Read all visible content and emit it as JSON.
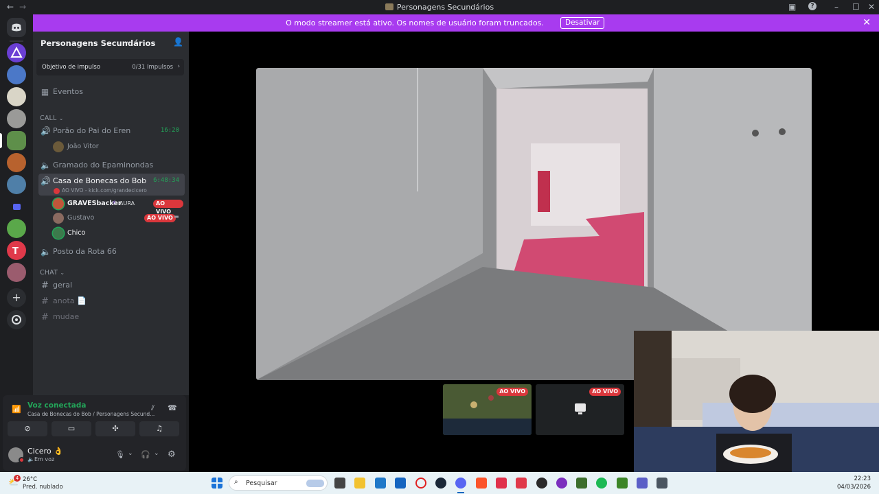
{
  "window": {
    "title": "Personagens Secundários"
  },
  "streamer_banner": {
    "message": "O modo streamer está ativo. Os nomes de usuário foram truncados.",
    "button": "Desativar"
  },
  "server": {
    "name": "Personagens Secundários",
    "boost_label": "Objetivo de impulso",
    "boost_count": "0/31 Impulsos",
    "events": "Eventos"
  },
  "categories": {
    "call": "CALL",
    "chat": "CHAT"
  },
  "voice_channels": [
    {
      "name": "Porão do Pai do Eren",
      "timer": "16:20"
    },
    {
      "name": "Gramado do Epaminondas"
    },
    {
      "name": "Casa de Bonecas do Bob",
      "timer": "6:48:34",
      "stream": "AO VIVO - kick.com/grandecicero"
    },
    {
      "name": "Posto da Rota 66"
    }
  ],
  "voice_users": {
    "joao": "João Vitor",
    "graves": "GRAVESbacker",
    "graves_tag": "AURA",
    "gustavo": "Gustavo",
    "chico": "Chico"
  },
  "live_label": "AO VIVO",
  "text_channels": [
    {
      "name": "geral"
    },
    {
      "name": "anota 📄"
    },
    {
      "name": "mudae"
    }
  ],
  "voice_panel": {
    "status": "Voz conectada",
    "location": "Casa de Bonecas do Bob / Personagens Secund..."
  },
  "user_panel": {
    "name": "Cicero 👌",
    "status": "Em voz"
  },
  "taskbar": {
    "temp": "26°C",
    "weather": "Pred. nublado",
    "weather_badge": "4",
    "search_placeholder": "Pesquisar",
    "time": "22:23",
    "date": "04/03/2026"
  },
  "colors": {
    "accent_streamer": "#a83bef",
    "live_red": "#da373c",
    "voice_green": "#23a559"
  }
}
